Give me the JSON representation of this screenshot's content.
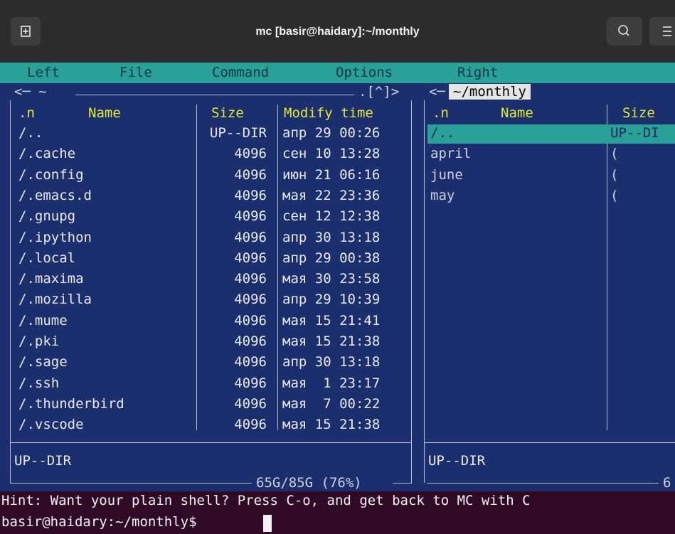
{
  "window": {
    "title": "mc [basir@haidary]:~/monthly"
  },
  "menubar": {
    "left": "Left",
    "file": "File",
    "command": "Command",
    "options": "Options",
    "right": "Right"
  },
  "left_panel": {
    "path": "<─ ~",
    "nav": ".[^]>",
    "headers": {
      "sort": ".n",
      "name": "Name",
      "size": "Size",
      "modify": "Modify time"
    },
    "rows": [
      {
        "name": "/..",
        "size": "UP--DIR",
        "date": "апр 29 00:26"
      },
      {
        "name": "/.cache",
        "size": "4096",
        "date": "сен 10 13:28"
      },
      {
        "name": "/.config",
        "size": "4096",
        "date": "июн 21 06:16"
      },
      {
        "name": "/.emacs.d",
        "size": "4096",
        "date": "мая 22 23:36"
      },
      {
        "name": "/.gnupg",
        "size": "4096",
        "date": "сен 12 12:38"
      },
      {
        "name": "/.ipython",
        "size": "4096",
        "date": "апр 30 13:18"
      },
      {
        "name": "/.local",
        "size": "4096",
        "date": "апр 29 00:38"
      },
      {
        "name": "/.maxima",
        "size": "4096",
        "date": "мая 30 23:58"
      },
      {
        "name": "/.mozilla",
        "size": "4096",
        "date": "апр 29 10:39"
      },
      {
        "name": "/.mume",
        "size": "4096",
        "date": "мая 15 21:41"
      },
      {
        "name": "/.pki",
        "size": "4096",
        "date": "мая 15 21:38"
      },
      {
        "name": "/.sage",
        "size": "4096",
        "date": "апр 30 13:18"
      },
      {
        "name": "/.ssh",
        "size": "4096",
        "date": "мая  1 23:17"
      },
      {
        "name": "/.thunderbird",
        "size": "4096",
        "date": "мая  7 00:22"
      },
      {
        "name": "/.vscode",
        "size": "4096",
        "date": "мая 15 21:38"
      }
    ],
    "status": "UP--DIR",
    "disk": "65G/85G (76%)"
  },
  "right_panel": {
    "arrow": "<─",
    "path": "~/monthly",
    "headers": {
      "sort": ".n",
      "name": "Name",
      "size": "Size"
    },
    "rows": [
      {
        "name": "/..",
        "size": "UP--DI",
        "selected": true
      },
      {
        "name": "april",
        "size": "("
      },
      {
        "name": "june",
        "size": "("
      },
      {
        "name": "may",
        "size": "("
      }
    ],
    "status": "UP--DIR",
    "disk": "6"
  },
  "hint": "Hint: Want your plain shell? Press C-o, and get back to MC with C",
  "prompt": "basir@haidary:~/monthly$ ",
  "colors": {
    "panel": "#1b2e6e",
    "menubar": "#2aa198",
    "header": "#e3e82f",
    "terminal": "#300a24"
  }
}
